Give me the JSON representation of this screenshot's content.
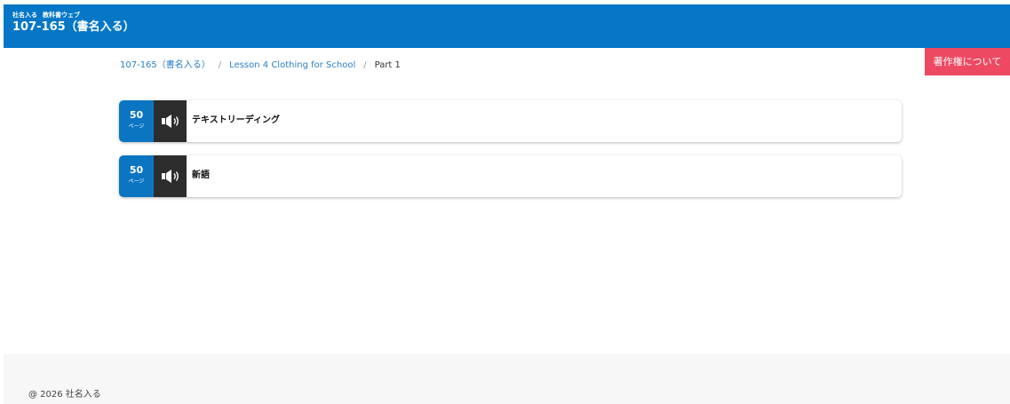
{
  "header": {
    "company": "社名入る",
    "site": "教科書ウェブ",
    "title": "107-165（書名入る）"
  },
  "copyright_button": {
    "label": "著作権について"
  },
  "breadcrumb": {
    "items": [
      "107-165（書名入る）",
      "Lesson 4 Clothing for School"
    ],
    "separator": "/",
    "current": "Part 1"
  },
  "items": [
    {
      "page": "50",
      "page_unit": "ページ",
      "label": "テキストリーディング",
      "icon": "speaker-icon"
    },
    {
      "page": "50",
      "page_unit": "ページ",
      "label": "新語",
      "icon": "speaker-icon"
    }
  ],
  "footer": {
    "copyright": "@ 2026 社名入る"
  },
  "colors": {
    "header_bg": "#0577c6",
    "accent_button": "#ee4962",
    "page_badge": "#0c75c2",
    "audio_bg": "#2d2d2d",
    "link": "#2a7fc4"
  }
}
